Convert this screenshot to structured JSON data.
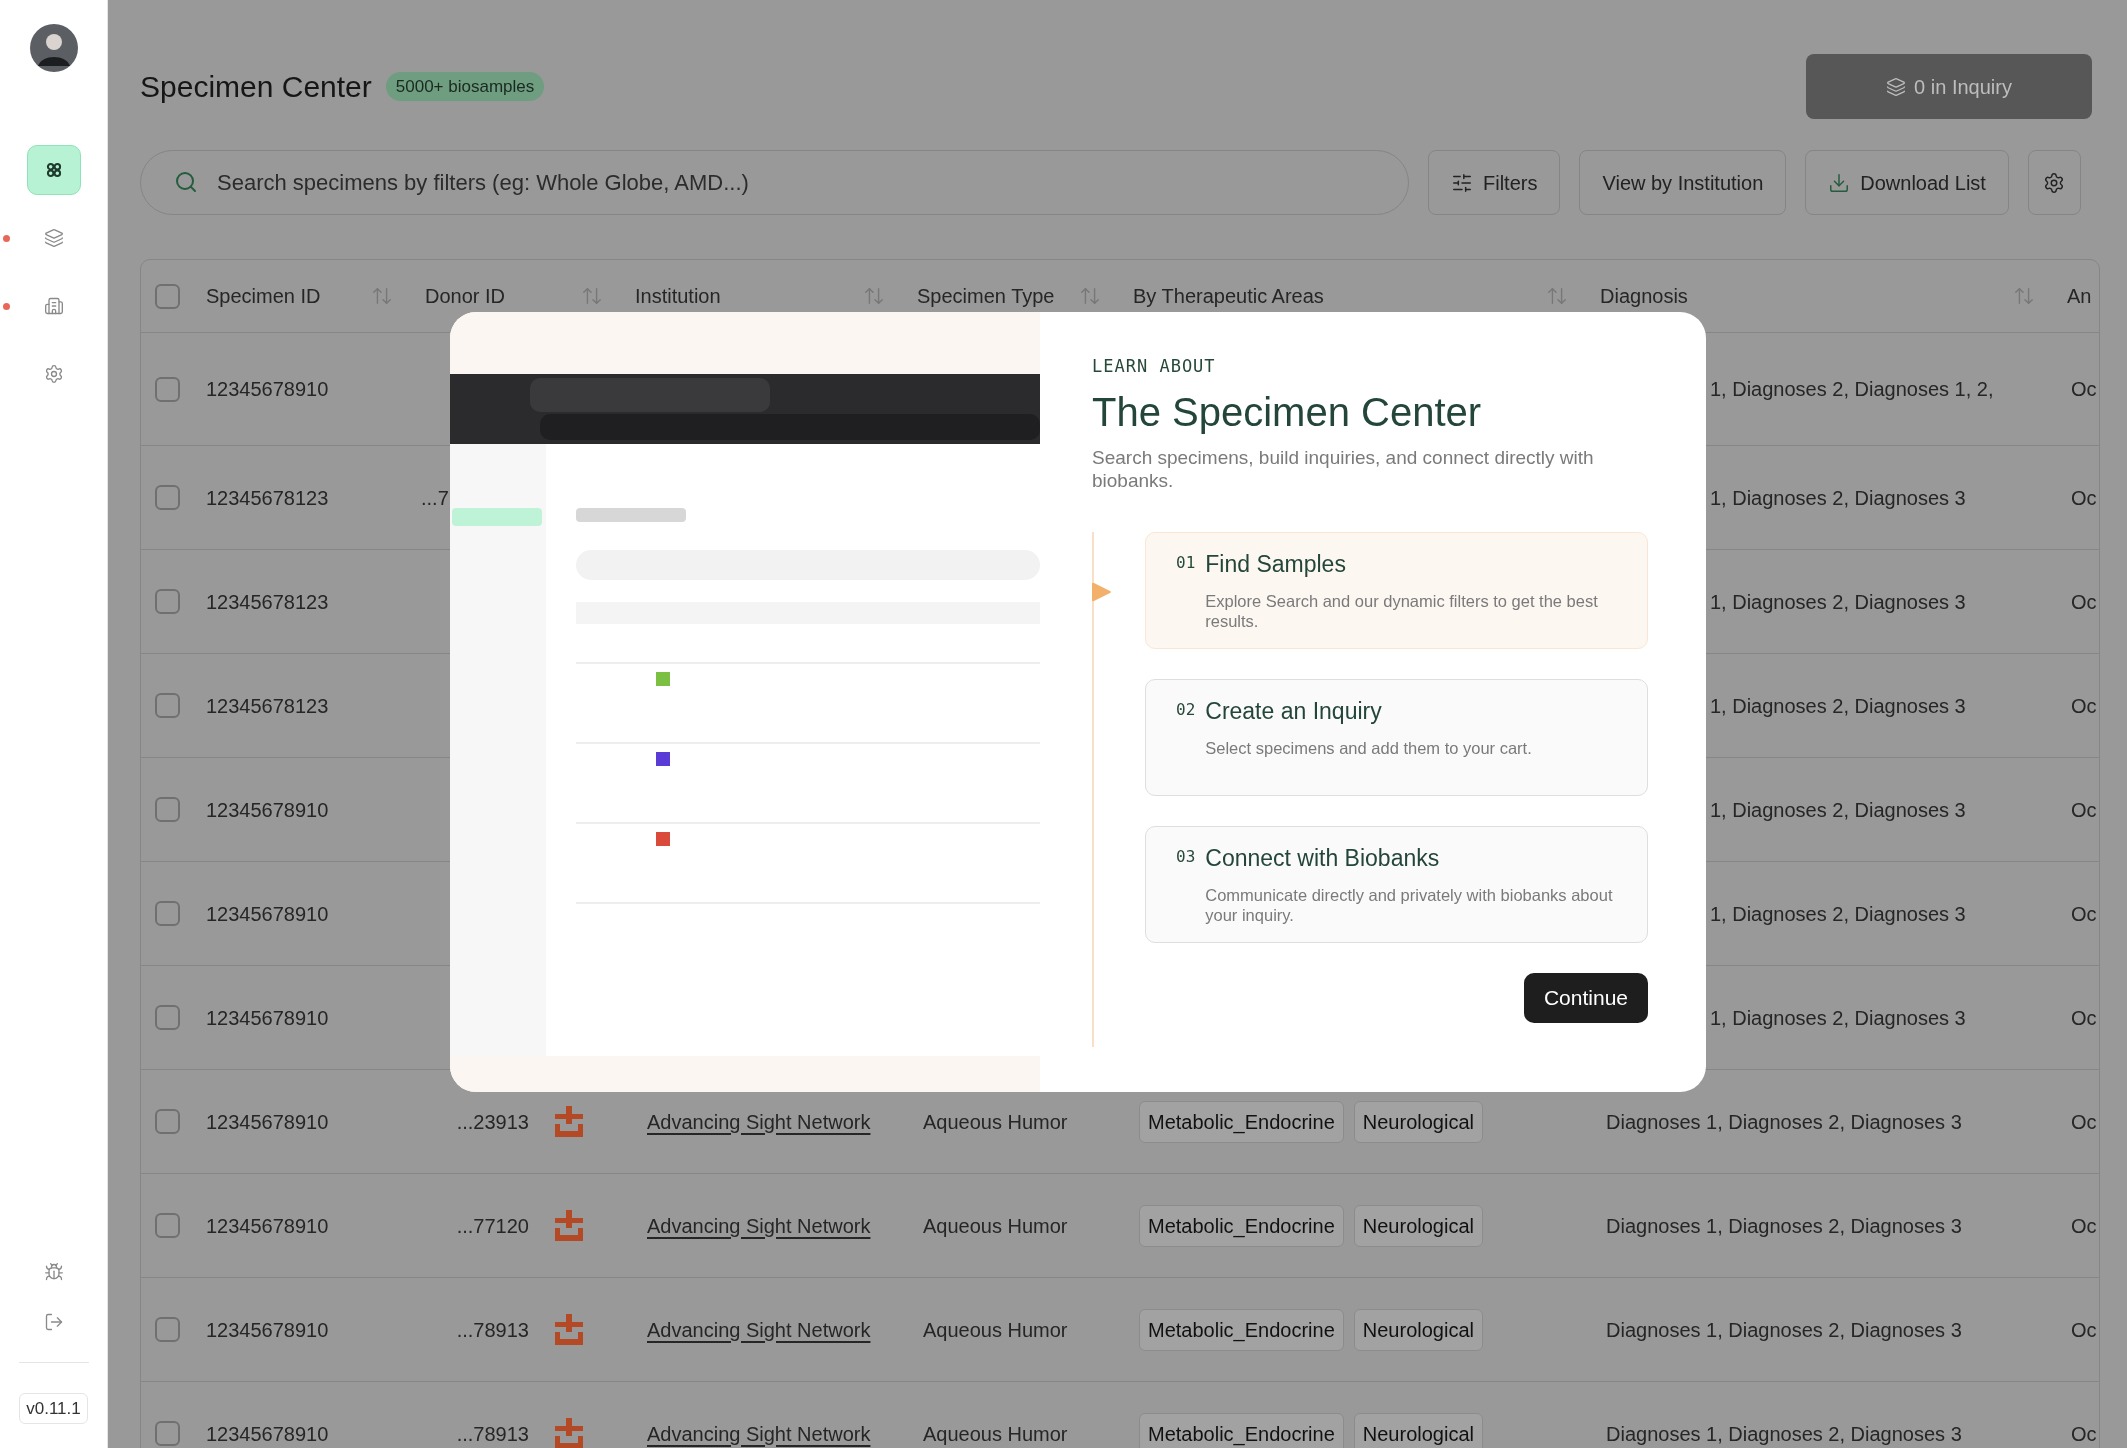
{
  "sidebar": {
    "items": [
      {
        "selected": true,
        "dot": false
      },
      {
        "selected": false,
        "dot": true
      },
      {
        "selected": false,
        "dot": true
      },
      {
        "selected": false,
        "dot": false
      }
    ],
    "version": "v0.11.1"
  },
  "header": {
    "title": "Specimen Center",
    "badge": "5000+ biosamples",
    "inquiry_button": "0 in Inquiry"
  },
  "toolbar": {
    "search": {
      "placeholder": "Search specimens by filters (eg: Whole Globe, AMD...)"
    },
    "buttons": [
      "Filters",
      "View by Institution",
      "Download List"
    ]
  },
  "table": {
    "select_all": {
      "checked": false
    },
    "columns": [
      {
        "label": "Specimen ID",
        "sortable": true
      },
      {
        "label": "Donor ID",
        "sortable": true
      },
      {
        "label": "Institution",
        "sortable": true
      },
      {
        "label": "Specimen Type",
        "sortable": true
      },
      {
        "label": "By Therapeutic Areas",
        "sortable": true
      },
      {
        "label": "Diagnosis",
        "sortable": true
      },
      {
        "label": "An",
        "sortable": false
      }
    ],
    "rows": [
      {
        "kind": "covered",
        "checked": false,
        "specimen_id": "12345678910",
        "diagnoses": "1, Diagnoses 2, Diagnoses 1, 2,",
        "column_8": "Oc"
      },
      {
        "kind": "covered",
        "checked": false,
        "specimen_id": "12345678123",
        "donor_id": "...7",
        "diagnoses": "1, Diagnoses 2, Diagnoses 3",
        "column_8": "Oc"
      },
      {
        "kind": "covered",
        "checked": false,
        "specimen_id": "12345678123",
        "diagnoses": "1, Diagnoses 2, Diagnoses 3",
        "column_8": "Oc"
      },
      {
        "kind": "covered",
        "checked": false,
        "specimen_id": "12345678123",
        "diagnoses": "1, Diagnoses 2, Diagnoses 3",
        "column_8": "Oc"
      },
      {
        "kind": "covered",
        "checked": false,
        "specimen_id": "12345678910",
        "diagnoses": "1, Diagnoses 2, Diagnoses 3",
        "column_8": "Oc"
      },
      {
        "kind": "covered",
        "checked": false,
        "specimen_id": "12345678910",
        "diagnoses": "1, Diagnoses 2, Diagnoses 3",
        "column_8": "Oc"
      },
      {
        "kind": "covered",
        "checked": false,
        "specimen_id": "12345678910",
        "diagnoses": "1, Diagnoses 2, Diagnoses 3",
        "column_8": "Oc"
      },
      {
        "kind": "full",
        "checked": false,
        "specimen_id": "12345678910",
        "donor_id": "...23913",
        "institution": "Advancing Sight Network",
        "specimen_type": "Aqueous Humor",
        "areas": [
          "Metabolic_Endocrine",
          "Neurological"
        ],
        "diagnoses": "Diagnoses 1, Diagnoses 2, Diagnoses 3",
        "column_8": "Oc"
      },
      {
        "kind": "full",
        "checked": false,
        "specimen_id": "12345678910",
        "donor_id": "...77120",
        "institution": "Advancing Sight Network",
        "specimen_type": "Aqueous Humor",
        "areas": [
          "Metabolic_Endocrine",
          "Neurological"
        ],
        "diagnoses": "Diagnoses 1, Diagnoses 2, Diagnoses 3",
        "column_8": "Oc"
      },
      {
        "kind": "full",
        "checked": false,
        "specimen_id": "12345678910",
        "donor_id": "...78913",
        "institution": "Advancing Sight Network",
        "specimen_type": "Aqueous Humor",
        "areas": [
          "Metabolic_Endocrine",
          "Neurological"
        ],
        "diagnoses": "Diagnoses 1, Diagnoses 2, Diagnoses 3",
        "column_8": "Oc"
      },
      {
        "kind": "full",
        "checked": false,
        "specimen_id": "12345678910",
        "donor_id": "...78913",
        "institution": "Advancing Sight Network",
        "specimen_type": "Aqueous Humor",
        "areas": [
          "Metabolic_Endocrine",
          "Neurological"
        ],
        "diagnoses": "Diagnoses 1, Diagnoses 2, Diagnoses 3",
        "column_8": "Oc"
      }
    ]
  },
  "modal": {
    "eyebrow": "LEARN ABOUT",
    "title": "The Specimen Center",
    "description": "Search specimens, build inquiries, and connect directly with biobanks.",
    "steps": [
      {
        "number": "01",
        "title": "Find Samples",
        "text": "Explore Search and our dynamic filters to get the best results.",
        "selected": true
      },
      {
        "number": "02",
        "title": "Create an Inquiry",
        "text": "Select specimens and add them to your cart.",
        "selected": false
      },
      {
        "number": "03",
        "title": "Connect with Biobanks",
        "text": "Communicate directly and privately with biobanks about your inquiry.",
        "selected": false
      }
    ],
    "button": "Continue"
  }
}
